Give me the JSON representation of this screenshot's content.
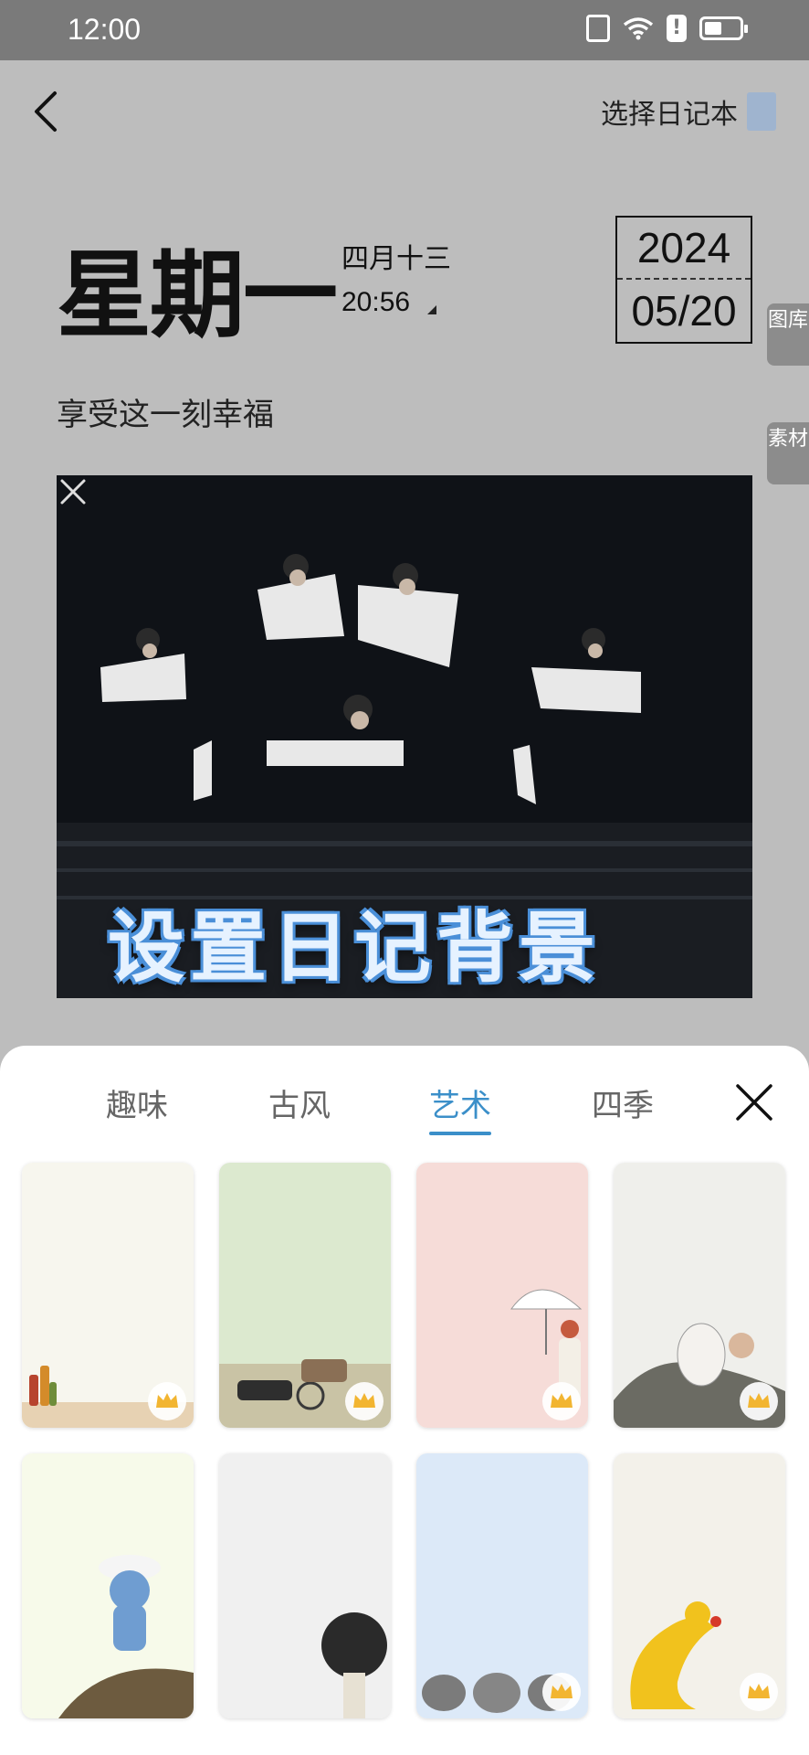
{
  "status_bar": {
    "time": "12:00"
  },
  "header": {
    "select_notebook": "选择日记本",
    "notebook_color": "#9fb4cf"
  },
  "entry": {
    "weekday": "星期一",
    "lunar_date": "四月十三",
    "time": "20:56",
    "year": "2024",
    "month_day": "05/20",
    "text": "享受这一刻幸福"
  },
  "side_tabs": {
    "gallery": "图库",
    "material": "素材"
  },
  "photo_caption": "设置日记背景",
  "sheet": {
    "tabs": [
      {
        "label": "趣味",
        "active": false
      },
      {
        "label": "古风",
        "active": false
      },
      {
        "label": "艺术",
        "active": true
      },
      {
        "label": "四季",
        "active": false
      }
    ],
    "backgrounds": [
      {
        "name": "vase-room",
        "premium": true
      },
      {
        "name": "horse-carriage",
        "premium": true
      },
      {
        "name": "umbrella-girl",
        "premium": true
      },
      {
        "name": "white-tiger",
        "premium": true
      },
      {
        "name": "smurf-cat",
        "premium": false
      },
      {
        "name": "microphone",
        "premium": false
      },
      {
        "name": "stone-monkeys",
        "premium": true
      },
      {
        "name": "banana-duck",
        "premium": true
      }
    ]
  },
  "colors": {
    "accent": "#3b8fc9",
    "crown": "#f2b531",
    "overlay": "#bdbdbd"
  }
}
